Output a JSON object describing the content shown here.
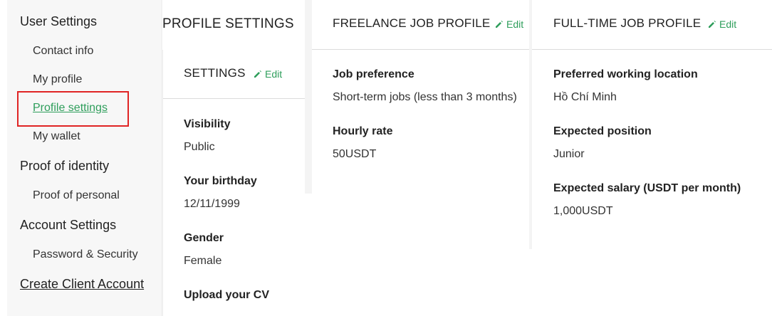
{
  "sidebar": {
    "user_settings": "User Settings",
    "contact_info": "Contact info",
    "my_profile": "My profile",
    "profile_settings": "Profile settings",
    "my_wallet": "My wallet",
    "proof_of_identity": "Proof of identity",
    "proof_of_personal": "Proof of personal",
    "account_settings": "Account Settings",
    "password_security": "Password & Security",
    "create_client_account": "Create Client Account"
  },
  "page": {
    "title": "PROFILE SETTINGS"
  },
  "settings_card": {
    "title": "SETTINGS",
    "edit_label": "Edit",
    "fields": [
      {
        "label": "Visibility",
        "value": "Public"
      },
      {
        "label": "Your birthday",
        "value": "12/11/1999"
      },
      {
        "label": "Gender",
        "value": "Female"
      },
      {
        "label": "Upload your CV",
        "value": ""
      }
    ]
  },
  "freelance_card": {
    "title": "FREELANCE JOB PROFILE",
    "edit_label": "Edit",
    "fields": [
      {
        "label": "Job preference",
        "value": "Short-term jobs (less than 3 months)"
      },
      {
        "label": "Hourly rate",
        "value": "50USDT"
      }
    ]
  },
  "fulltime_card": {
    "title": "FULL-TIME JOB PROFILE",
    "edit_label": "Edit",
    "fields": [
      {
        "label": "Preferred working location",
        "value": "Hồ Chí Minh"
      },
      {
        "label": "Expected position",
        "value": "Junior"
      },
      {
        "label": "Expected salary (USDT per month)",
        "value": "1,000USDT"
      }
    ]
  },
  "colors": {
    "accent": "#2e9e5b",
    "highlight_border": "#e02424"
  },
  "icons": {
    "edit": "pencil-icon"
  }
}
